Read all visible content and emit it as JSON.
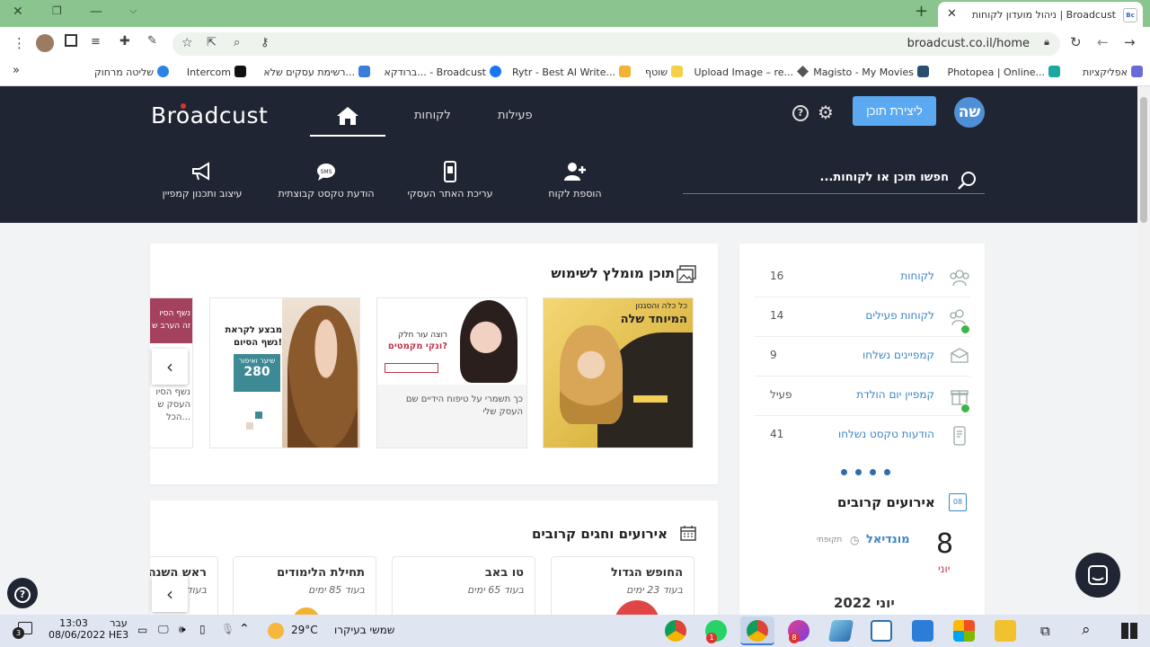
{
  "browser": {
    "tab_title": "ניהול מועדון לקוחות | Broadcust",
    "favicon_text": "Bc",
    "url": "broadcust.co.il/home",
    "bookmarks": [
      "אפליקציות",
      "Photopea | Online...",
      "Magisto - My Movies",
      "Upload Image – re...",
      "שוטף",
      "Rytr - Best AI Write...",
      "ברודקא... - Broadcust",
      "רשימת עסקים שלא...",
      "Intercom",
      "שליטה מרחוק"
    ]
  },
  "header": {
    "logo": "Broadcust",
    "nav": {
      "activity": "פעילות",
      "customers": "לקוחות"
    },
    "create_button": "ליצירת תוכן",
    "avatar": "שה",
    "quick_actions": [
      "הוספת לקוח",
      "עריכת האתר העסקי",
      "הודעת טקסט קבוצתית",
      "עיצוב ותכנון קמפיין"
    ],
    "search_placeholder": "חפשו תוכן או לקוחות..."
  },
  "recommended": {
    "title": "תוכן מומלץ לשימוש",
    "items": [
      {
        "img_line1": "כל כלה והסגנון",
        "img_line2": "המיוחד שלה",
        "caption": ""
      },
      {
        "img_line1": "רוצה עור חלק",
        "img_line2": "ונקי מקמטים?",
        "caption": "כך תשמרי על טיפוח הידיים שם העסק שלי"
      },
      {
        "img_line1": "מבצע לקראת",
        "img_line2": "נשף הסיום!",
        "price_label": "שיער ואיפור",
        "price": "280",
        "caption": ""
      },
      {
        "img_line1": "נשף הסיו",
        "img_line2": "זה הערב ש",
        "caption": "נשף הסיו העסק ש הכל..."
      }
    ]
  },
  "events": {
    "title": "אירועים וחגים קרובים",
    "items": [
      {
        "name": "החופש הגדול",
        "when": "בעוד 23 ימים"
      },
      {
        "name": "טו באב",
        "when": "בעוד 65 ימים"
      },
      {
        "name": "תחילת הלימודים",
        "when": "בעוד 85 ימים"
      },
      {
        "name": "ראש השנה",
        "when": "בעוד"
      }
    ]
  },
  "stats": [
    {
      "label": "לקוחות",
      "value": "16",
      "icon": "users-icon",
      "dot": false
    },
    {
      "label": "לקוחות פעילים",
      "value": "14",
      "icon": "active-users-icon",
      "dot": true
    },
    {
      "label": "קמפיינים נשלחו",
      "value": "9",
      "icon": "campaign-icon",
      "dot": false
    },
    {
      "label": "קמפיין יום הולדת",
      "value": "פעיל",
      "icon": "gift-icon",
      "dot": true
    },
    {
      "label": "הודעות טקסט נשלחו",
      "value": "41",
      "icon": "sms-icon",
      "dot": false
    }
  ],
  "upcoming": {
    "title": "אירועים קרובים",
    "calendar_number": "08",
    "event_day": "8",
    "event_month": "יוני",
    "event_name": "מונדיאל",
    "event_tag": "תקופתי",
    "month_header": "יוני 2022"
  },
  "taskbar": {
    "weather": "שמשי בעיקרו",
    "temperature": "29°C",
    "time": "13:03",
    "date": "08/06/2022",
    "lang_line1": "עבר",
    "lang_line2": "HE3",
    "notif_count": "3",
    "whatsapp_badge": "1",
    "app_badge": "8"
  },
  "colors": {
    "header_bg": "#1f2532",
    "accent": "#5aa9f1",
    "link": "#3d86c6",
    "tab_bar": "#8bc48f"
  }
}
